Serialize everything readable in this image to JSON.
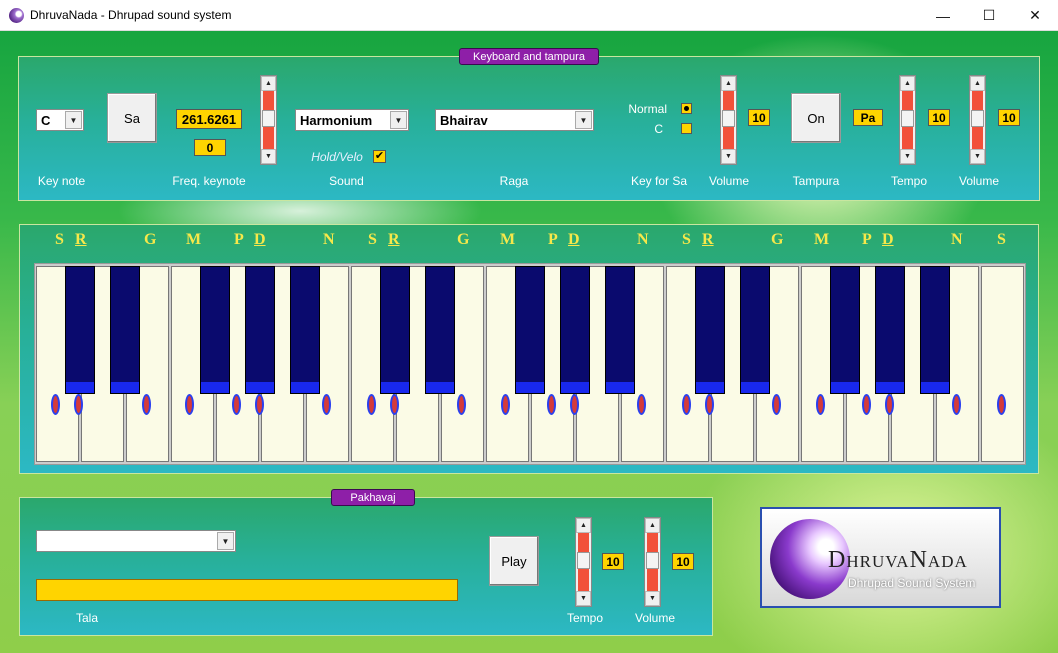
{
  "window": {
    "title": "DhruvaNada - Dhrupad sound system",
    "min": "—",
    "max": "☐",
    "close": "✕"
  },
  "keyboard_panel": {
    "title": "Keyboard and tampura",
    "key_note": {
      "value": "C",
      "label": "Key note"
    },
    "sa_button": "Sa",
    "freq": {
      "value": "261.6261",
      "offset": "0",
      "label": "Freq. keynote"
    },
    "sound": {
      "value": "Harmonium",
      "label": "Sound"
    },
    "hold_velo": "Hold/Velo",
    "raga": {
      "value": "Bhairav",
      "label": "Raga"
    },
    "key_for_sa": {
      "normal": "Normal",
      "c": "C",
      "label": "Key for Sa"
    },
    "volume": {
      "value": "10",
      "label": "Volume"
    },
    "tampura": {
      "button": "On",
      "label": "Tampura"
    },
    "pa": "Pa",
    "tempo": {
      "value": "10",
      "label": "Tempo"
    },
    "volume2": {
      "value": "10",
      "label": "Volume"
    }
  },
  "sargam": [
    "S",
    "R",
    "G",
    "M",
    "P",
    "D",
    "N",
    "S",
    "R",
    "G",
    "M",
    "P",
    "D",
    "N",
    "S",
    "R",
    "G",
    "M",
    "P",
    "D",
    "N",
    "S"
  ],
  "pakhavaj_panel": {
    "title": "Pakhavaj",
    "tala_label": "Tala",
    "play": "Play",
    "tempo": {
      "value": "10",
      "label": "Tempo"
    },
    "volume": {
      "value": "10",
      "label": "Volume"
    }
  },
  "logo": {
    "name": "DhruvaNada",
    "subtitle": "Dhrupad Sound System"
  }
}
